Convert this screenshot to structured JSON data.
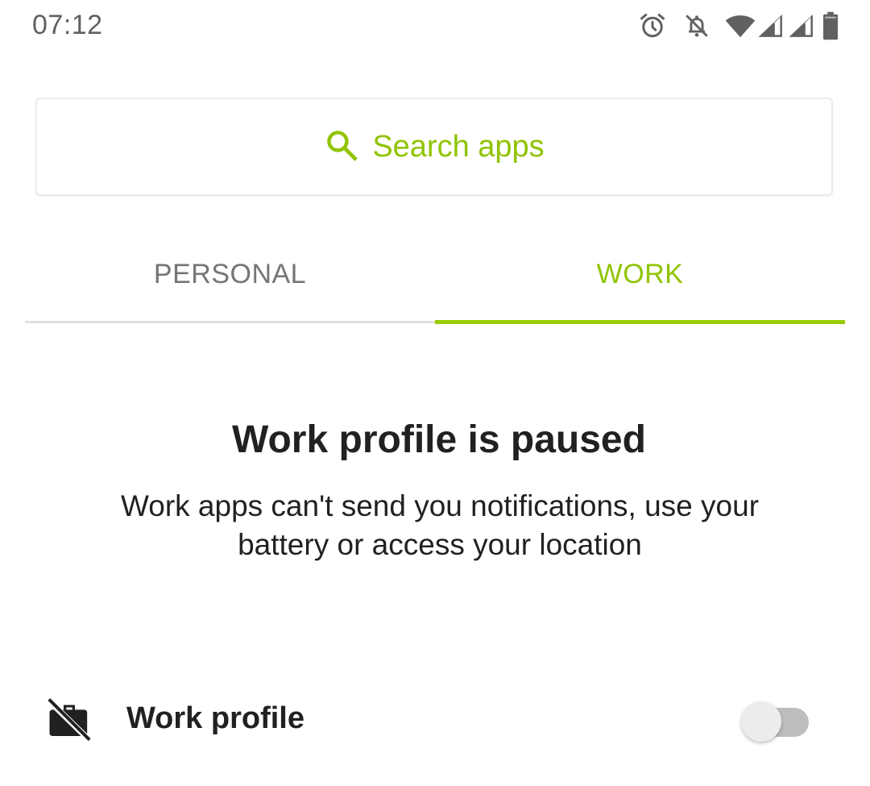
{
  "status_bar": {
    "time": "07:12",
    "icons": [
      "alarm-icon",
      "notifications-off-icon",
      "wifi-icon",
      "cell-signal-icon",
      "cell-signal-icon",
      "battery-icon"
    ],
    "icon_color": "#616161"
  },
  "search": {
    "placeholder": "Search apps",
    "icon": "search-icon",
    "accent_color": "#8fc400"
  },
  "tabs": [
    {
      "label": "PERSONAL",
      "selected": false
    },
    {
      "label": "WORK",
      "selected": true
    }
  ],
  "paused": {
    "title": "Work profile is paused",
    "description": "Work apps can't send you notifications, use your battery or access your location"
  },
  "work_profile": {
    "icon": "work-off-icon",
    "label": "Work profile",
    "toggle_on": false
  }
}
